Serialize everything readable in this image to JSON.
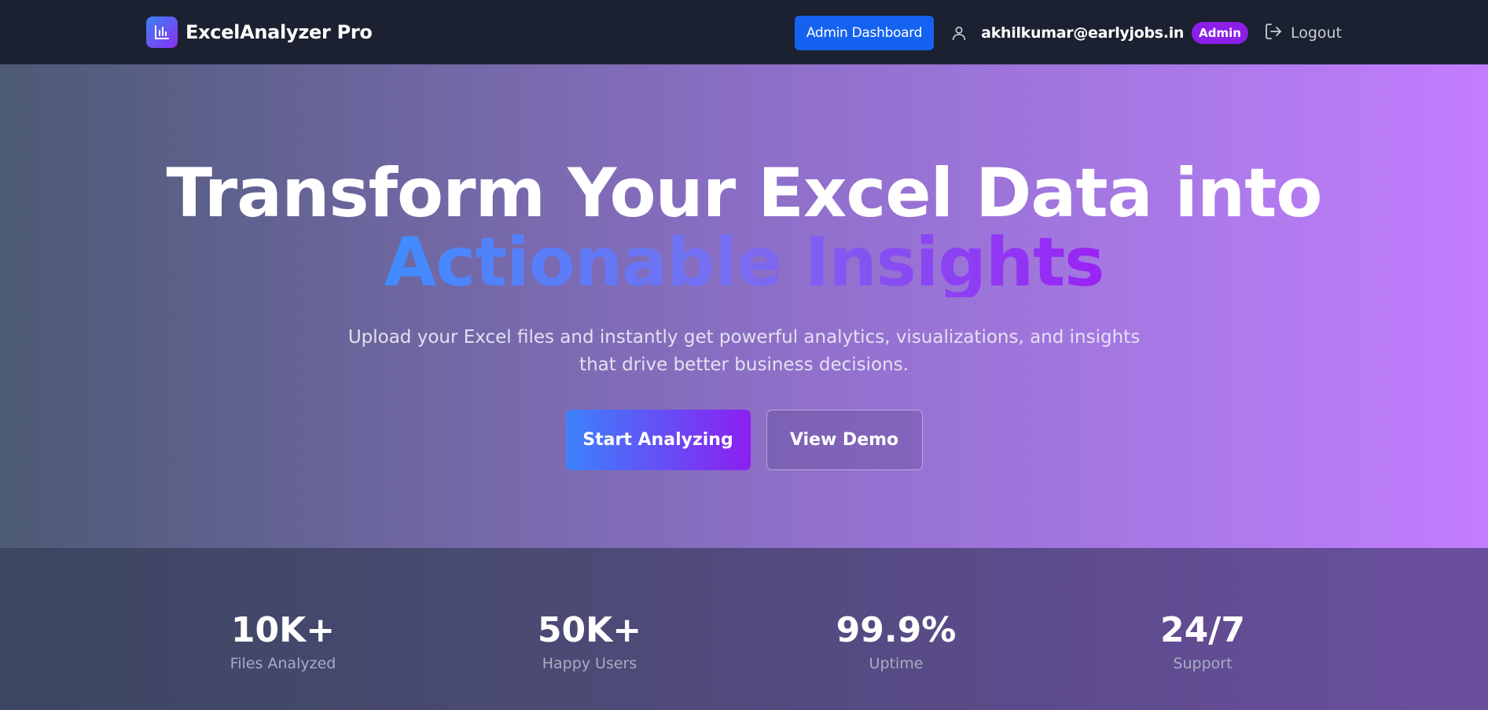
{
  "navbar": {
    "brand_name": "ExcelAnalyzer Pro",
    "logo_icon": "bar-chart-icon",
    "admin_dashboard_label": "Admin Dashboard",
    "user_icon": "user-icon",
    "user_email": "akhilkumar@earlyjobs.in",
    "role_badge": "Admin",
    "logout_icon": "logout-icon",
    "logout_label": "Logout"
  },
  "hero": {
    "title_line1": "Transform Your Excel Data into",
    "title_line2": "Actionable Insights",
    "subtitle_line1": "Upload your Excel files and instantly get powerful analytics, visualizations, and insights",
    "subtitle_line2": "that drive better business decisions.",
    "primary_cta": "Start Analyzing",
    "secondary_cta": "View Demo"
  },
  "stats": [
    {
      "value": "10K+",
      "label": "Files Analyzed"
    },
    {
      "value": "50K+",
      "label": "Happy Users"
    },
    {
      "value": "99.9%",
      "label": "Uptime"
    },
    {
      "value": "24/7",
      "label": "Support"
    }
  ],
  "colors": {
    "navbar_bg": "#1b2131",
    "admin_button": "#1662f0",
    "badge": "#8b1fe8",
    "hero_gradient_start": "#4c5a74",
    "hero_gradient_end": "#c37cff",
    "accent_start": "#3f8cff",
    "accent_end": "#9a22f5"
  }
}
